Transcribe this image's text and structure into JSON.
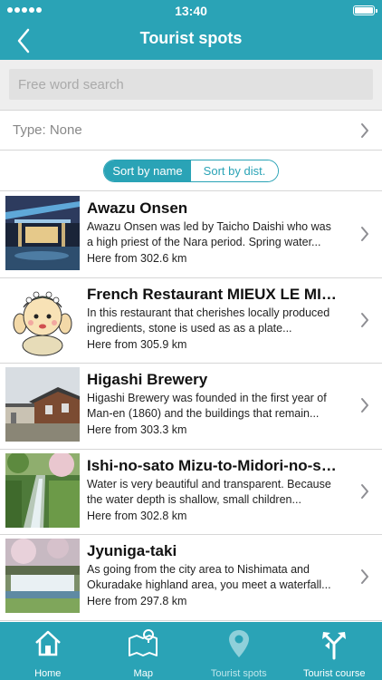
{
  "status": {
    "time": "13:40"
  },
  "header": {
    "title": "Tourist spots",
    "back_icon": "chevron-left-icon"
  },
  "search": {
    "placeholder": "Free word search",
    "value": ""
  },
  "filter": {
    "type_label": "Type: None"
  },
  "sort": {
    "options": [
      "Sort by name",
      "Sort by dist."
    ],
    "selected": "Sort by name"
  },
  "spots": [
    {
      "title": "Awazu Onsen",
      "description": "Awazu Onsen was led by Taicho Daishi who was a high priest of the Nara period. Spring water...",
      "distance": "Here from 302.6 km"
    },
    {
      "title": "French Restaurant MIEUX LE MIEUX",
      "description": "In this restaurant that cherishes locally produced ingredients, stone is used as as a plate...",
      "distance": "Here from 305.9 km"
    },
    {
      "title": "Higashi Brewery",
      "description": "Higashi Brewery was founded in the first year of Man-en (1860) and the buildings that remain...",
      "distance": "Here from 303.3 km"
    },
    {
      "title": "Ishi-no-sato Mizu-to-Midori-no-sato",
      "description": "Water is very beautiful and transparent. Because the water depth is shallow, small children...",
      "distance": "Here from 302.8 km"
    },
    {
      "title": "Jyuniga-taki",
      "description": "As going from the city area to Nishimata and Okuradake highland area, you meet a waterfall...",
      "distance": "Here from 297.8 km"
    }
  ],
  "tabs": [
    {
      "label": "Home",
      "icon": "home-icon"
    },
    {
      "label": "Map",
      "icon": "map-icon"
    },
    {
      "label": "Tourist spots",
      "icon": "location-pin-icon",
      "active": true
    },
    {
      "label": "Tourist course",
      "icon": "signpost-icon"
    }
  ],
  "colors": {
    "accent": "#2aa3b6",
    "background": "#ffffff",
    "divider": "#d6d6d6"
  }
}
